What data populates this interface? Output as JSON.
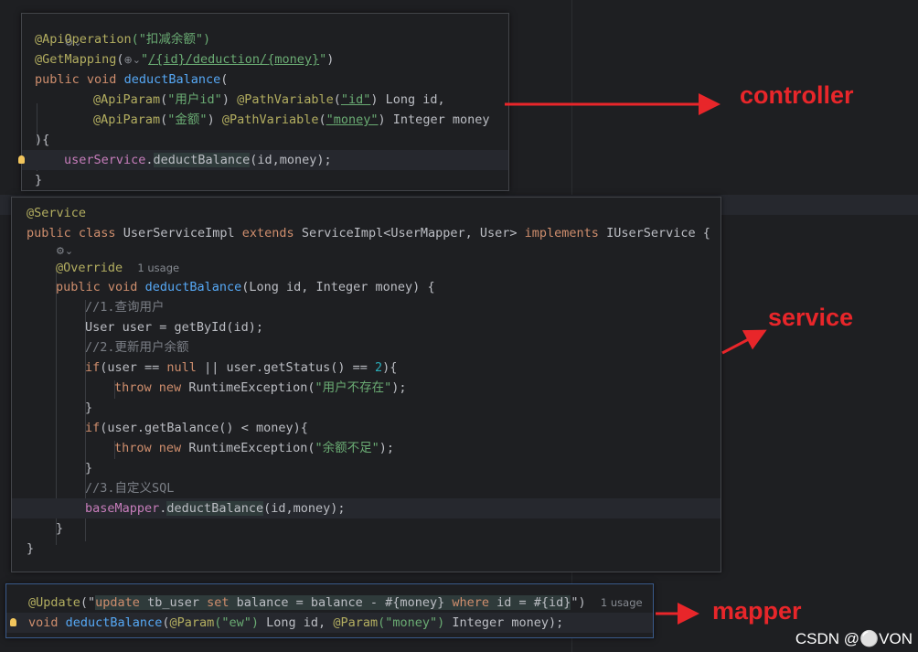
{
  "controller": {
    "gear": "⚙⌄",
    "ann1": "@ApiOperation",
    "ann1_arg": "(\"扣减余额\")",
    "ann2": "@GetMapping",
    "ann2_open": "(",
    "ann2_glob": "⊕⌄",
    "ann2_q1": "\"",
    "path_slash1": "/",
    "path_id": "{id}",
    "path_mid": "/deduction/",
    "path_money": "{money}",
    "ann2_q2": "\"",
    "ann2_close": ")",
    "kw_public": "public",
    "kw_void": "void",
    "method": "deductBalance",
    "paren_open": "(",
    "p1_ann": "@ApiParam",
    "p1_arg_open": "(",
    "p1_label": "\"用户id\"",
    "p1_arg_close": ") ",
    "p1_pv": "@PathVariable",
    "p1_pv_open": "(",
    "p1_name": "\"id\"",
    "p1_rest": ") Long id,",
    "p2_ann": "@ApiParam",
    "p2_arg_open": "(",
    "p2_label": "\"金额\"",
    "p2_arg_close": ") ",
    "p2_pv": "@PathVariable",
    "p2_pv_open": "(",
    "p2_name": "\"money\"",
    "p2_rest": ") Integer money",
    "close_sig": "){",
    "call_field": "userService",
    "call_dot": ".",
    "call_method": "deductBalance",
    "call_args": "(id,money);",
    "close_brace": "}"
  },
  "service": {
    "ann": "@Service",
    "kw_public": "public",
    "kw_class": "class",
    "class_name": "UserServiceImpl",
    "kw_extends": "extends",
    "super": "ServiceImpl<UserMapper, User>",
    "kw_implements": "implements",
    "iface": "IUserService {",
    "gear": "⚙⌄",
    "override": "@Override",
    "usage": "1 usage",
    "kw_public2": "public",
    "kw_void": "void",
    "method": "deductBalance",
    "params": "(Long id, Integer money) {",
    "c1": "//1.查询用户",
    "l_user": "User user = getById(id);",
    "c2": "//2.更新用户余额",
    "if1_kw": "if",
    "if1_a": "(user == ",
    "if1_null": "null",
    "if1_b": " || user.getStatus() == ",
    "if1_num": "2",
    "if1_c": "){",
    "throw_kw": "throw",
    "new_kw": "new",
    "ex": "RuntimeException(",
    "ex1_msg": "\"用户不存在\"",
    "ex_end": ");",
    "brace": "}",
    "if2_kw": "if",
    "if2_rest": "(user.getBalance() < money){",
    "ex2_msg": "\"余额不足\"",
    "c3": "//3.自定义SQL",
    "base_field": "baseMapper",
    "base_dot": ".",
    "base_method": "deductBalance",
    "base_args": "(id,money);"
  },
  "mapper": {
    "ann": "@Update",
    "q_open": "(\"",
    "sql_update": "update",
    "sql_table": " tb_user ",
    "sql_set": "set",
    "sql_col": " balance = balance - #{money} ",
    "sql_where": "where",
    "sql_cond": " id = #{id}",
    "q_close": "\")",
    "usage": "1 usage",
    "kw_void": "void",
    "method": "deductBalance",
    "p_open": "(",
    "p_ann1": "@Param",
    "p_arg1": "(\"ew\")",
    "p_mid": " Long id, ",
    "p_ann2": "@Param",
    "p_arg2": "(\"money\")",
    "p_end": " Integer money);"
  },
  "labels": {
    "controller": "controller",
    "service": "service",
    "mapper": "mapper"
  },
  "colors": {
    "arrow": "#e8262a",
    "background": "#1e1f22"
  },
  "watermark": "CSDN @⚪VON"
}
